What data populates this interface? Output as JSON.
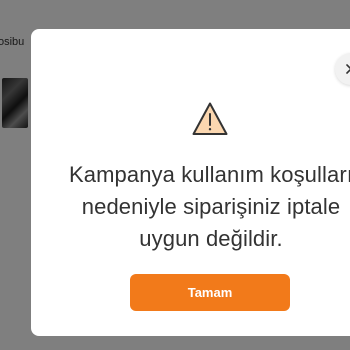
{
  "background": {
    "partial_text": "osibu"
  },
  "modal": {
    "message_lines": [
      "Kampanya kullanım koşulları",
      "nedeniyle siparişiniz iptale",
      "uygun değildir."
    ],
    "ok_label": "Tamam",
    "icons": {
      "warning": "warning-triangle-icon",
      "close": "close-icon"
    }
  },
  "colors": {
    "accent": "#f27a1a",
    "text": "#333333",
    "overlay": "rgba(0,0,0,0.5)"
  }
}
